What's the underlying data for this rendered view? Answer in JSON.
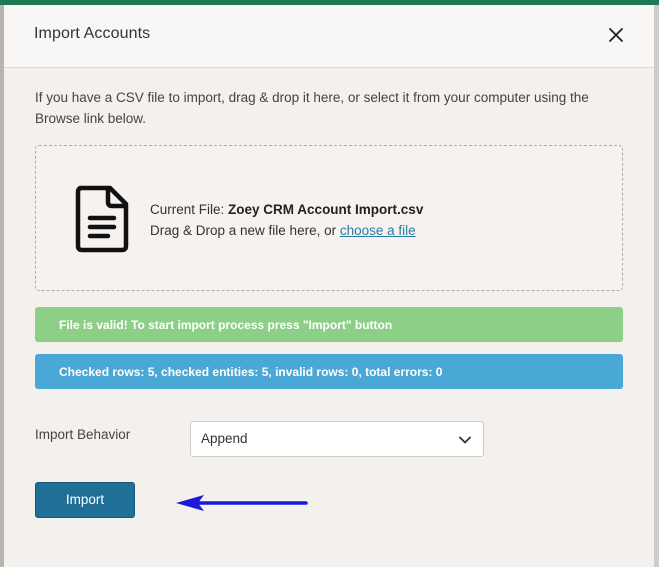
{
  "modal": {
    "title": "Import Accounts",
    "intro": "If you have a CSV file to import, drag & drop it here, or select it from your computer using the Browse link below."
  },
  "dropzone": {
    "current_file_label": "Current File:",
    "current_file_name": "Zoey CRM Account Import.csv",
    "drag_text": "Drag & Drop a new file here, or",
    "choose_link": "choose a file",
    "icon": "document-icon"
  },
  "alerts": {
    "success": "File is valid! To start import process press \"Import\" button",
    "info": "Checked rows: 5, checked entities: 5, invalid rows: 0, total errors: 0"
  },
  "form": {
    "behavior_label": "Import Behavior",
    "behavior_value": "Append"
  },
  "actions": {
    "import_label": "Import"
  },
  "colors": {
    "brand_green": "#1a7a52",
    "success": "#8ecf88",
    "info": "#4aa8d6",
    "primary_button": "#1f6f96",
    "annotation_arrow": "#1a1adb"
  }
}
